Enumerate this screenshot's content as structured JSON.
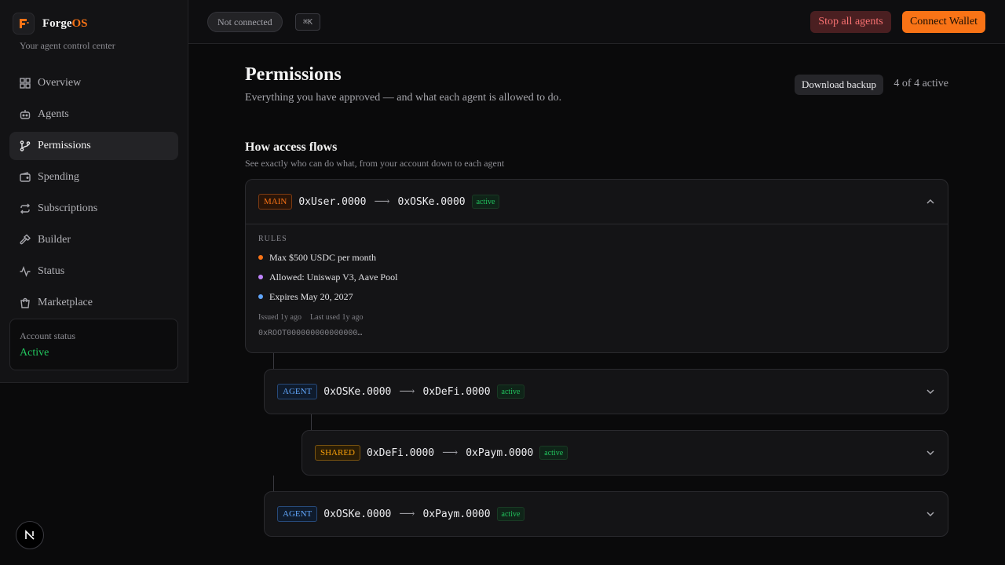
{
  "brand": {
    "name_prefix": "Forge",
    "name_accent": "OS",
    "tagline": "Your agent control center"
  },
  "nav": [
    {
      "label": "Overview",
      "icon": "grid-icon"
    },
    {
      "label": "Agents",
      "icon": "bot-icon"
    },
    {
      "label": "Permissions",
      "icon": "branch-icon",
      "active": true
    },
    {
      "label": "Spending",
      "icon": "wallet-icon"
    },
    {
      "label": "Subscriptions",
      "icon": "repeat-icon"
    },
    {
      "label": "Builder",
      "icon": "hammer-icon"
    },
    {
      "label": "Status",
      "icon": "activity-icon"
    },
    {
      "label": "Marketplace",
      "icon": "bag-icon"
    }
  ],
  "account": {
    "label": "Account status",
    "value": "Active"
  },
  "topbar": {
    "connection": "Not connected",
    "shortcut": "⌘K",
    "stop_label": "Stop all agents",
    "connect_label": "Connect Wallet"
  },
  "page": {
    "title": "Permissions",
    "subtitle": "Everything you have approved — and what each agent is allowed to do.",
    "backup_label": "Download backup",
    "active_count": "4 of 4 active"
  },
  "section": {
    "title": "How access flows",
    "subtitle": "See exactly who can do what, from your account down to each agent"
  },
  "flows": [
    {
      "tag": "MAIN",
      "from": "0xUser.0000",
      "arrow": "⟶",
      "to": "0xOSKe.0000",
      "status": "active",
      "expanded": true,
      "rules_label": "RULES",
      "rules": [
        {
          "text": "Max $500 USDC per month",
          "color": "#f97316"
        },
        {
          "text": "Allowed: Uniswap V3, Aave Pool",
          "color": "#c084fc"
        },
        {
          "text": "Expires May 20, 2027",
          "color": "#60a5fa"
        }
      ],
      "issued": "Issued 1y ago",
      "last_used": "Last used 1y ago",
      "hash": "0xROOT000000000000000…"
    },
    {
      "tag": "AGENT",
      "from": "0xOSKe.0000",
      "arrow": "⟶",
      "to": "0xDeFi.0000",
      "status": "active"
    },
    {
      "tag": "SHARED",
      "from": "0xDeFi.0000",
      "arrow": "⟶",
      "to": "0xPaym.0000",
      "status": "active"
    },
    {
      "tag": "AGENT",
      "from": "0xOSKe.0000",
      "arrow": "⟶",
      "to": "0xPaym.0000",
      "status": "active"
    }
  ],
  "colors": {
    "accent": "#f97316",
    "success": "#22c55e",
    "danger": "#f87171",
    "info": "#60a5fa"
  }
}
